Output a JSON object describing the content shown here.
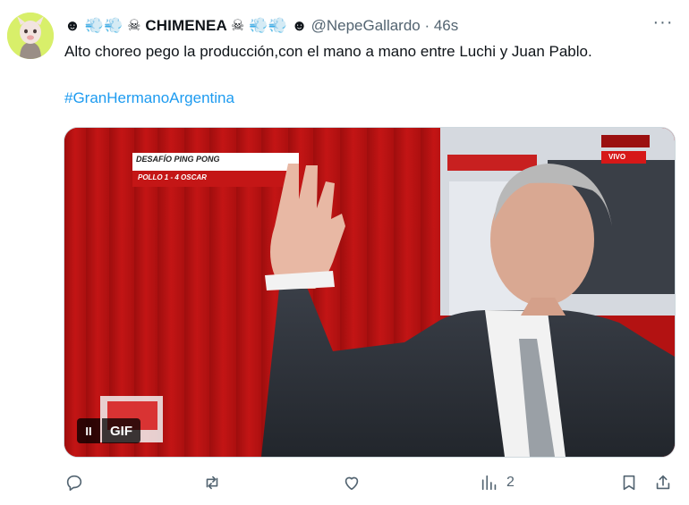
{
  "tweet": {
    "author_name_prefix": "☻",
    "author_name": "CHIMENEA",
    "author_name_suffix": "☻",
    "handle_time": "@NepeGallardo · 46s",
    "more_label": "···",
    "text": "Alto choreo pego la producción,con el mano a mano entre Luchi y Juan Pablo.",
    "hashtag": "#GranHermanoArgentina",
    "media": {
      "lower_third_title": "DESAFÍO PING PONG",
      "lower_third_score": "POLLO 1 - 4 OSCAR",
      "live_badge": "VIVO",
      "gif_label": "GIF",
      "pause_label": "II"
    },
    "actions": {
      "views_count": "2"
    }
  },
  "colors": {
    "accent": "#1d9bf0",
    "muted": "#536471",
    "background": "#ffffff"
  }
}
